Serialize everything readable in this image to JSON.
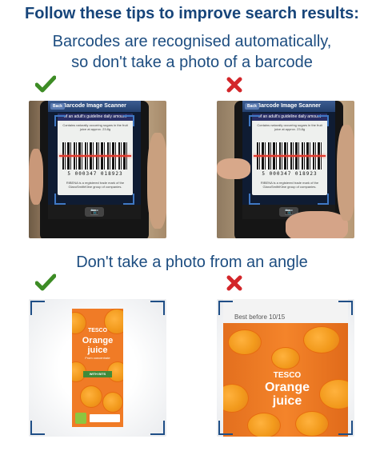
{
  "heading": "Follow these tips to improve search results:",
  "tip1": {
    "line1": "Barcodes are recognised automatically,",
    "line2": "so don't take a photo of a barcode",
    "good_mark": "✔",
    "bad_mark": "✖"
  },
  "tip2": {
    "line1": "Don't take a photo from an angle",
    "good_mark": "✔",
    "bad_mark": "✖"
  },
  "phone": {
    "nav_title": "Barcode Image Scanner",
    "back_label": "Back",
    "label_head": "of an adult's guideline daily amount",
    "small_text": "Contains naturally occurring sugars in the fruit juice at approx. 23.8g",
    "barcode_digits": "5 000347 018923",
    "label_footer": "RIBENA is a registered trade mark of the GlaxoSmithKline group of companies.",
    "camera_icon": "📷"
  },
  "carton": {
    "brand": "TESCO",
    "product_line1": "Orange",
    "product_line2": "juice",
    "subtitle": "From concentrate",
    "band_text": "WITH BITS",
    "angled_top_text": "Best before  10/15"
  },
  "colors": {
    "good": "#3d8c25",
    "bad": "#d3262a",
    "heading": "#17457a",
    "frame": "#1f4e86"
  }
}
